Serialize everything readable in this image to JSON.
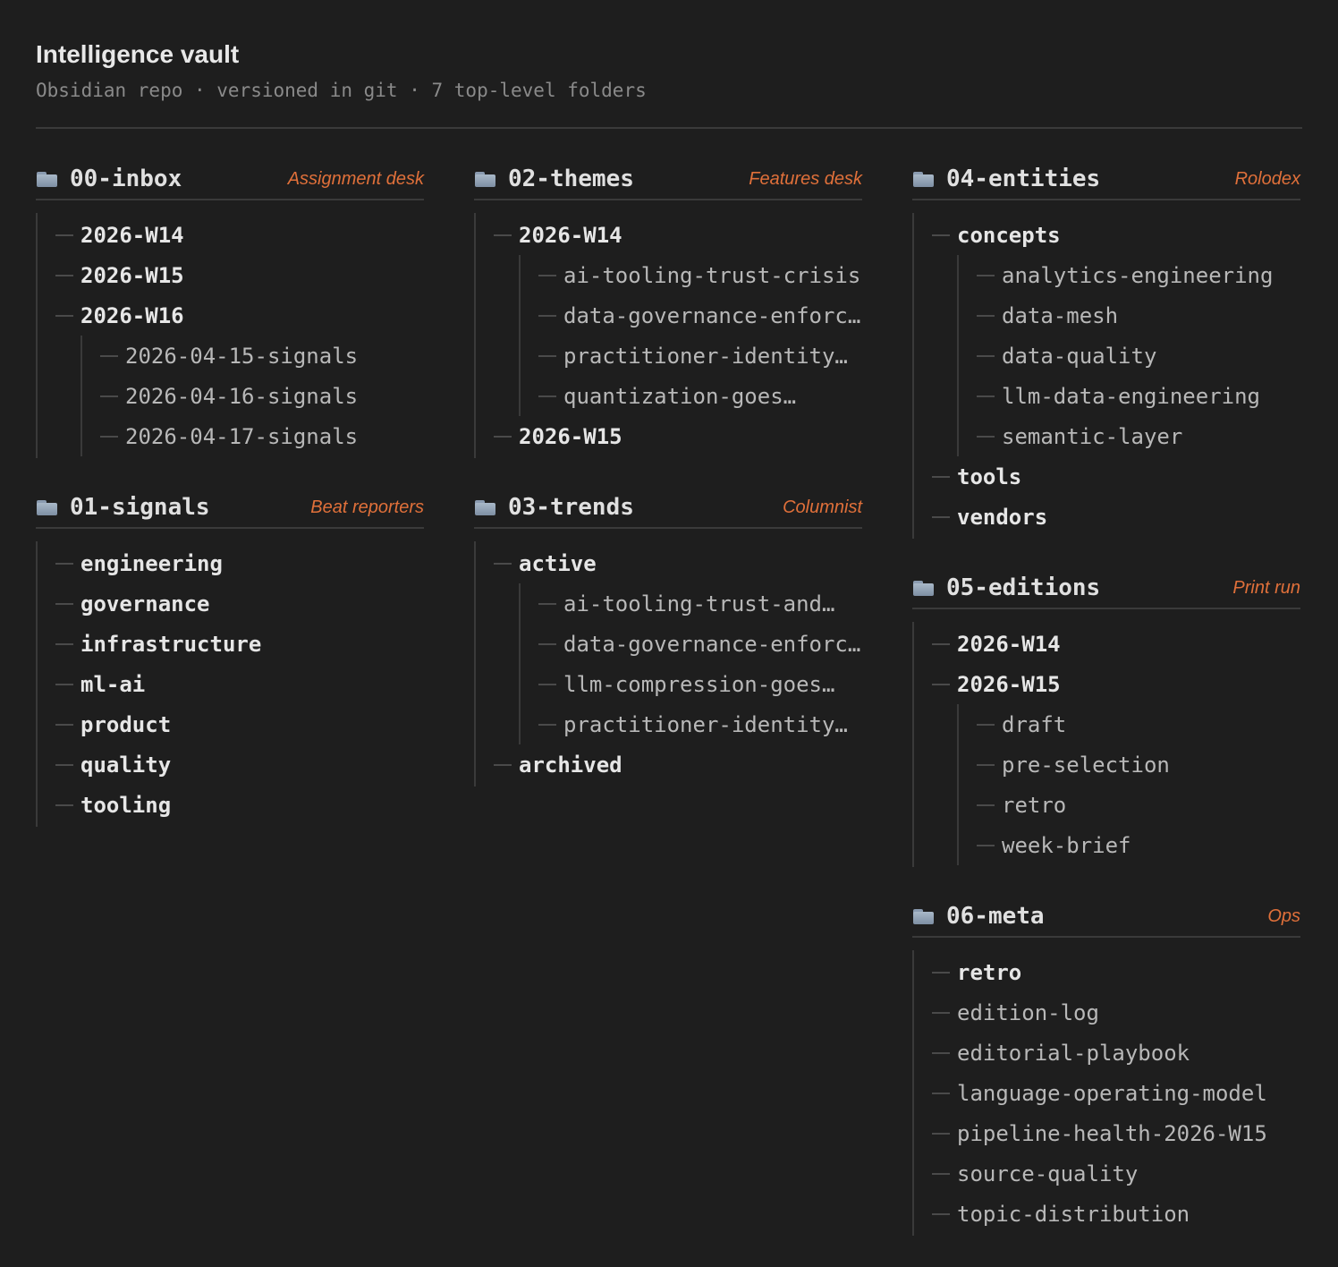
{
  "header": {
    "title": "Intelligence vault",
    "subtitle": "Obsidian repo · versioned in git · 7 top-level folders"
  },
  "sections": {
    "inbox": {
      "name": "00-inbox",
      "role": "Assignment desk",
      "items": [
        "2026-W14",
        "2026-W15",
        "2026-W16"
      ],
      "w16_children": [
        "2026-04-15-signals",
        "2026-04-16-signals",
        "2026-04-17-signals"
      ]
    },
    "signals": {
      "name": "01-signals",
      "role": "Beat reporters",
      "items": [
        "engineering",
        "governance",
        "infrastructure",
        "ml-ai",
        "product",
        "quality",
        "tooling"
      ]
    },
    "themes": {
      "name": "02-themes",
      "role": "Features desk",
      "items": [
        "2026-W14",
        "2026-W15"
      ],
      "w14_children": [
        "ai-tooling-trust-crisis",
        "data-governance-enforc…",
        "practitioner-identity…",
        "quantization-goes…"
      ]
    },
    "trends": {
      "name": "03-trends",
      "role": "Columnist",
      "items": [
        "active",
        "archived"
      ],
      "active_children": [
        "ai-tooling-trust-and…",
        "data-governance-enforc…",
        "llm-compression-goes…",
        "practitioner-identity…"
      ]
    },
    "entities": {
      "name": "04-entities",
      "role": "Rolodex",
      "items": [
        "concepts",
        "tools",
        "vendors"
      ],
      "concepts_children": [
        "analytics-engineering",
        "data-mesh",
        "data-quality",
        "llm-data-engineering",
        "semantic-layer"
      ]
    },
    "editions": {
      "name": "05-editions",
      "role": "Print run",
      "items": [
        "2026-W14",
        "2026-W15"
      ],
      "w15_children": [
        "draft",
        "pre-selection",
        "retro",
        "week-brief"
      ]
    },
    "meta": {
      "name": "06-meta",
      "role": "Ops",
      "items": [
        "retro",
        "edition-log",
        "editorial-playbook",
        "language-operating-model",
        "pipeline-health-2026-W15",
        "source-quality",
        "topic-distribution"
      ]
    }
  },
  "colors": {
    "background": "#1e1e1e",
    "accent": "#e0703a",
    "divider": "#3a3a3a"
  }
}
